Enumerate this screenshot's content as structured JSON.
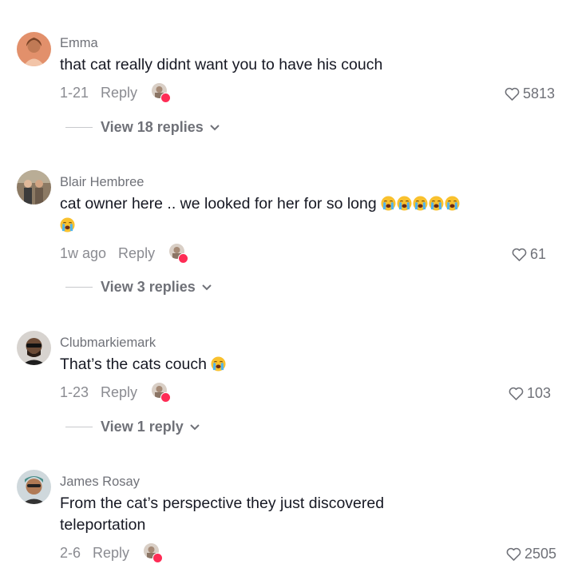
{
  "comments": [
    {
      "username": "Emma",
      "text": "that cat really didnt want you to have his couch",
      "emoji_count": 0,
      "date": "1-21",
      "reply_label": "Reply",
      "likes": "5813",
      "view_replies": "View 18 replies",
      "avatar_color": "#e2906b"
    },
    {
      "username": "Blair Hembree",
      "text": "cat owner here .. we looked for her for so long",
      "emoji_count": 6,
      "emoji": "loudly-crying-face",
      "date": "1w ago",
      "reply_label": "Reply",
      "likes": "61",
      "view_replies": "View 3 replies",
      "avatar_color": "#6b5a4a"
    },
    {
      "username": "Clubmarkiemark",
      "text": "That’s the cats couch",
      "emoji_count": 1,
      "emoji": "loudly-crying-face",
      "date": "1-23",
      "reply_label": "Reply",
      "likes": "103",
      "view_replies": "View 1 reply",
      "avatar_color": "#3a2a22"
    },
    {
      "username": "James Rosay",
      "text": "From the cat’s perspective they just discovered teleportation",
      "emoji_count": 0,
      "date": "2-6",
      "reply_label": "Reply",
      "likes": "2505",
      "avatar_color": "#4a8f8a"
    }
  ],
  "colors": {
    "text": "#161823",
    "muted": "#8a8b91",
    "creator_badge": "#fe2c55"
  },
  "icons": {
    "like": "heart-outline-icon",
    "expand": "chevron-down-icon",
    "creator": "creator-avatar-heart-badge"
  }
}
